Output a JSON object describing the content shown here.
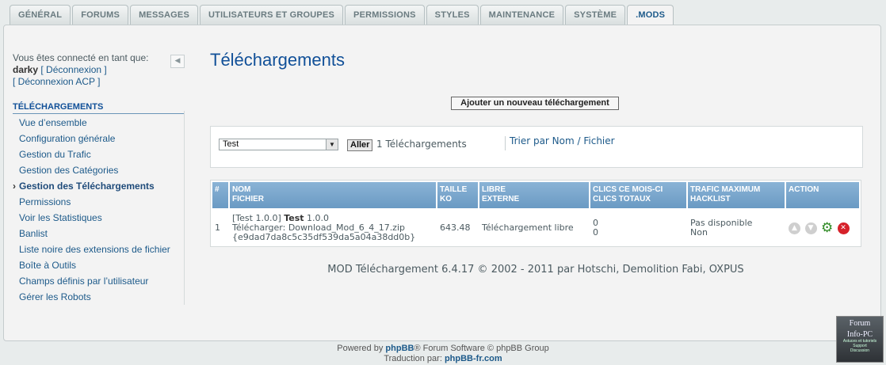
{
  "tabs": [
    "GÉNÉRAL",
    "FORUMS",
    "MESSAGES",
    "UTILISATEURS ET GROUPES",
    "PERMISSIONS",
    "STYLES",
    "MAINTENANCE",
    "SYSTÈME",
    ".MODS"
  ],
  "sidebar": {
    "logged_in_label": "Vous êtes connecté en tant que:",
    "username": "darky",
    "logout": "[ Déconnexion ]",
    "logout_acp": "[ Déconnexion ACP ]",
    "collapse_icon": "◀",
    "section_title": "TÉLÉCHARGEMENTS",
    "items": [
      "Vue d’ensemble",
      "Configuration générale",
      "Gestion du Trafic",
      "Gestion des Catégories",
      "Gestion des Téléchargements",
      "Permissions",
      "Voir les Statistiques",
      "Banlist",
      "Liste noire des extensions de fichier",
      "Boîte à Outils",
      "Champs définis par l’utilisateur",
      "Gérer les Robots"
    ],
    "active_index": 4
  },
  "main": {
    "title": "Téléchargements",
    "add_button": "Ajouter un nouveau téléchargement",
    "filter": {
      "category_value": "Test",
      "go_button": "Aller",
      "count": "1 Téléchargements",
      "sort_link": "Trier par Nom / Fichier"
    },
    "table": {
      "headers": {
        "num": "#",
        "name": "NOM",
        "file": "FICHIER",
        "size": "TAILLE",
        "size_unit": "KO",
        "free": "LIBRE",
        "external": "EXTERNE",
        "clicks_month": "CLICS CE MOIS-CI",
        "clicks_total": "CLICS TOTAUX",
        "traffic": "TRAFIC MAXIMUM",
        "hacklist": "HACKLIST",
        "action": "ACTION"
      },
      "rows": [
        {
          "num": "1",
          "prefix": "[Test 1.0.0]",
          "name_bold": "Test",
          "version": "1.0.0",
          "file": "Télécharger: Download_Mod_6_4_17.zip",
          "hash": "{e9dad7da8c5c35df539da5a04a38dd0b}",
          "size": "643.48",
          "free": "Téléchargement libre",
          "clicks_month": "0",
          "clicks_total": "0",
          "traffic": "Pas disponible",
          "hacklist": "Non"
        }
      ]
    },
    "mod_footer": "MOD Téléchargement 6.4.17 © 2002 - 2011 par Hotschi, Demolition Fabi, OXPUS"
  },
  "footer": {
    "powered_pre": "Powered by ",
    "phpbb": "phpBB",
    "powered_post": "® Forum Software © phpBB Group",
    "translation_pre": "Traduction par: ",
    "translation_link": "phpBB-fr.com"
  },
  "badge": {
    "line1": "Forum",
    "line2": "Info-PC",
    "line3": "Astuces et tutoriels",
    "line4": "Support",
    "line5": "Discussion"
  },
  "colors": {
    "accent": "#115098",
    "header_blue": "#6a9ac3",
    "delete_red": "#d6212a",
    "edit_green": "#2f8a24"
  }
}
